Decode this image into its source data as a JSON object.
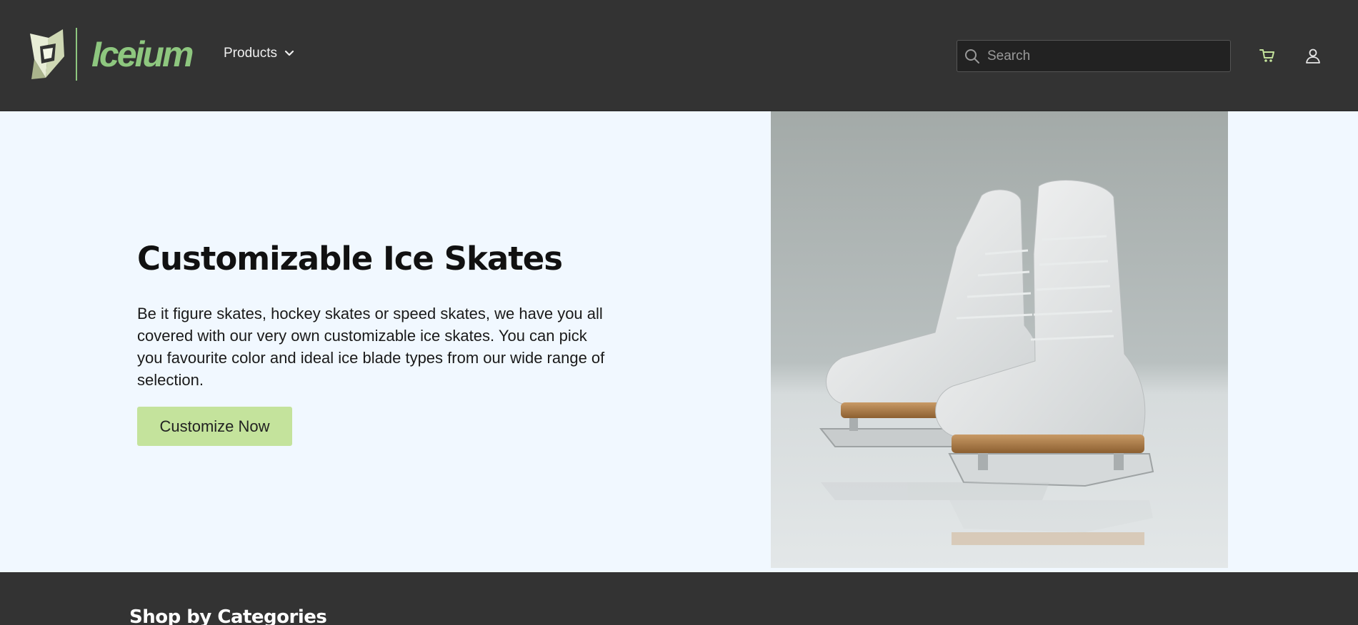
{
  "header": {
    "brand_name": "Iceium",
    "nav": {
      "products_label": "Products"
    },
    "search": {
      "placeholder": "Search"
    },
    "icons": [
      "logo-icon",
      "chevron-down-icon",
      "search-icon",
      "cart-icon",
      "user-icon"
    ]
  },
  "hero": {
    "title": "Customizable Ice Skates",
    "description": "Be it figure skates, hockey skates or speed skates, we have you all covered with our very own customizable ice skates. You can pick you favourite color and ideal ice blade types from our wide range of selection.",
    "cta_label": "Customize Now"
  },
  "categories": {
    "title": "Shop by Categories"
  },
  "colors": {
    "header_bg": "#333333",
    "brand_green": "#8ec77f",
    "hero_bg": "#f1f8ff",
    "cta_bg": "#c4e39c"
  }
}
